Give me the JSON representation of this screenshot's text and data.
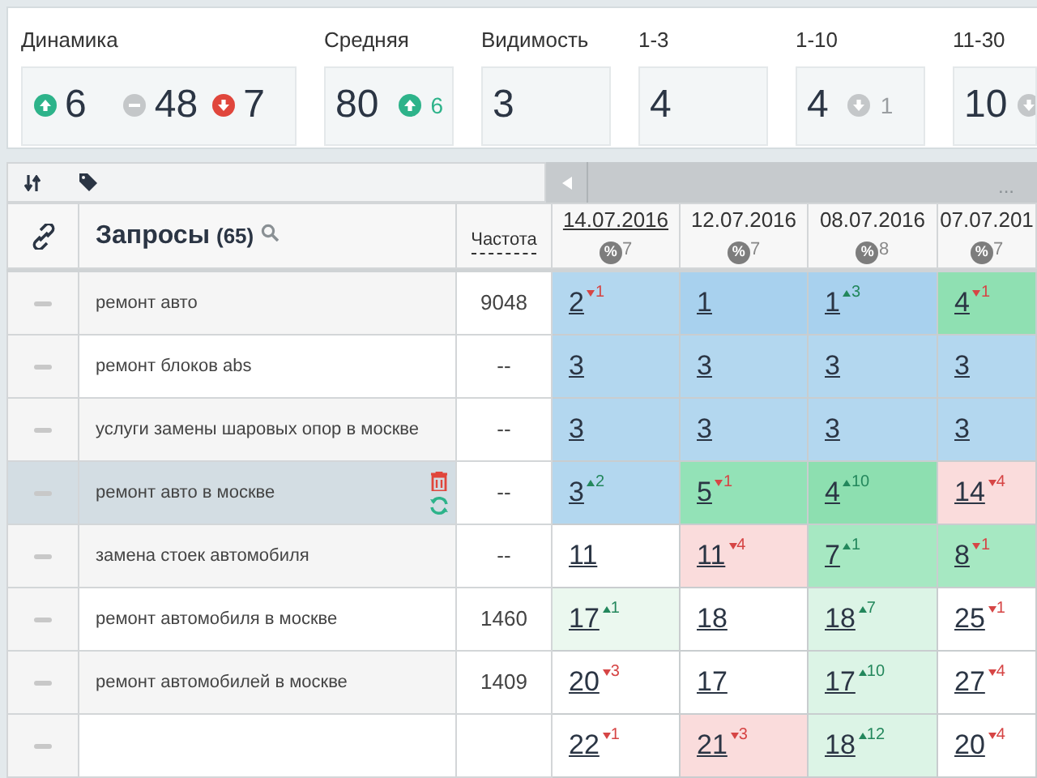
{
  "stats": [
    {
      "label": "Динамика",
      "kind": "dynamics",
      "items": [
        {
          "kind": "up",
          "value": "6"
        },
        {
          "kind": "same",
          "value": "48"
        },
        {
          "kind": "down",
          "value": "7"
        }
      ]
    },
    {
      "label": "Средняя",
      "kind": "value",
      "value": "80",
      "change": {
        "kind": "up",
        "value": "6",
        "muted": false
      }
    },
    {
      "label": "Видимость",
      "kind": "value",
      "value": "3"
    },
    {
      "label": "1-3",
      "kind": "value",
      "value": "4"
    },
    {
      "label": "1-10",
      "kind": "value",
      "value": "4",
      "change": {
        "kind": "down",
        "value": "1",
        "muted": true
      }
    },
    {
      "label": "11-30",
      "kind": "value",
      "value": "10",
      "change": {
        "kind": "down",
        "muted": true
      }
    }
  ],
  "toolbar": {
    "more": "..."
  },
  "table": {
    "query_header": "Запросы",
    "query_count": "(65)",
    "frequency_header": "Частота",
    "dates": [
      {
        "date": "14.07.2016",
        "badge": "%",
        "percent": "7",
        "selected": true
      },
      {
        "date": "12.07.2016",
        "badge": "%",
        "percent": "7",
        "selected": false
      },
      {
        "date": "08.07.2016",
        "badge": "%",
        "percent": "8",
        "selected": false
      },
      {
        "date": "07.07.201",
        "badge": "%",
        "percent": "7",
        "selected": false
      }
    ],
    "rows": [
      {
        "query": "ремонт авто",
        "frequency": "9048",
        "selected": false,
        "positions": [
          {
            "value": "2",
            "delta": "1",
            "kind": "down",
            "color": "#b3d7ef"
          },
          {
            "value": "1",
            "color": "#a8d1ee"
          },
          {
            "value": "1",
            "delta": "3",
            "kind": "up",
            "color": "#a8d1ee"
          },
          {
            "value": "4",
            "delta": "1",
            "kind": "down",
            "color": "#8fe0b2"
          }
        ]
      },
      {
        "query": "ремонт блоков abs",
        "frequency": "--",
        "selected": false,
        "positions": [
          {
            "value": "3",
            "color": "#b3d7ef"
          },
          {
            "value": "3",
            "color": "#b3d7ef"
          },
          {
            "value": "3",
            "color": "#b3d7ef"
          },
          {
            "value": "3",
            "color": "#b3d7ef"
          }
        ]
      },
      {
        "query": "услуги замены шаровых опор в москве",
        "frequency": "--",
        "selected": false,
        "positions": [
          {
            "value": "3",
            "color": "#b3d7ef"
          },
          {
            "value": "3",
            "color": "#b3d7ef"
          },
          {
            "value": "3",
            "color": "#b3d7ef"
          },
          {
            "value": "3",
            "color": "#b3d7ef"
          }
        ]
      },
      {
        "query": "ремонт авто в москве",
        "frequency": "--",
        "selected": true,
        "positions": [
          {
            "value": "3",
            "delta": "2",
            "kind": "up",
            "color": "#b3d7ef"
          },
          {
            "value": "5",
            "delta": "1",
            "kind": "down",
            "color": "#93e2b7"
          },
          {
            "value": "4",
            "delta": "10",
            "kind": "up",
            "color": "#8ddfb0"
          },
          {
            "value": "14",
            "delta": "4",
            "kind": "down",
            "color": "#fadcdc"
          }
        ]
      },
      {
        "query": "замена стоек автомобиля",
        "frequency": "--",
        "selected": false,
        "positions": [
          {
            "value": "11",
            "color": "#ffffff"
          },
          {
            "value": "11",
            "delta": "4",
            "kind": "down",
            "color": "#fadcdc"
          },
          {
            "value": "7",
            "delta": "1",
            "kind": "up",
            "color": "#a6e8c2"
          },
          {
            "value": "8",
            "delta": "1",
            "kind": "down",
            "color": "#a6e8c2"
          }
        ]
      },
      {
        "query": "ремонт автомобиля в москве",
        "frequency": "1460",
        "selected": false,
        "positions": [
          {
            "value": "17",
            "delta": "1",
            "kind": "up",
            "color": "#ebf8ef"
          },
          {
            "value": "18",
            "color": "#ffffff"
          },
          {
            "value": "18",
            "delta": "7",
            "kind": "up",
            "color": "#dcf4e6"
          },
          {
            "value": "25",
            "delta": "1",
            "kind": "down",
            "color": "#ffffff"
          }
        ]
      },
      {
        "query": "ремонт автомобилей в москве",
        "frequency": "1409",
        "selected": false,
        "positions": [
          {
            "value": "20",
            "delta": "3",
            "kind": "down",
            "color": "#ffffff"
          },
          {
            "value": "17",
            "color": "#ffffff"
          },
          {
            "value": "17",
            "delta": "10",
            "kind": "up",
            "color": "#dcf4e6"
          },
          {
            "value": "27",
            "delta": "4",
            "kind": "down",
            "color": "#ffffff"
          }
        ]
      },
      {
        "selected": false,
        "positions": [
          {
            "value": "22",
            "delta": "1",
            "kind": "down",
            "color": "#ffffff"
          },
          {
            "value": "21",
            "delta": "3",
            "kind": "down",
            "color": "#fadcdc"
          },
          {
            "value": "18",
            "delta": "12",
            "kind": "up",
            "color": "#dcf4e6"
          },
          {
            "value": "20",
            "delta": "4",
            "kind": "down",
            "color": "#ffffff"
          }
        ]
      }
    ]
  }
}
